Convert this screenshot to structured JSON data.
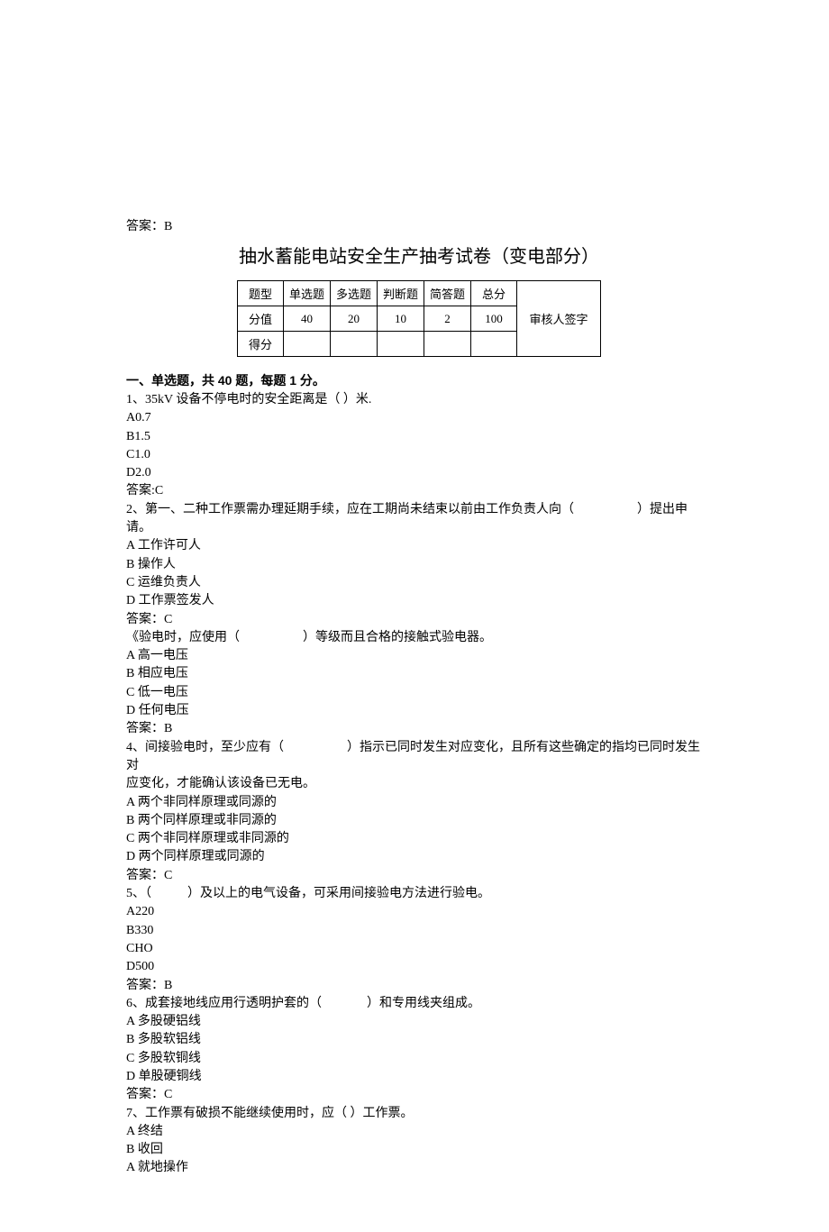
{
  "top_answer": "答案：B",
  "title": "抽水蓄能电站安全生产抽考试卷（变电部分）",
  "score_table": {
    "headers": [
      "题型",
      "单选题",
      "多选题",
      "判断题",
      "简答题",
      "总分",
      "审核人签字"
    ],
    "rows": [
      {
        "label": "分值",
        "cells": [
          "40",
          "20",
          "10",
          "2",
          "100",
          ""
        ]
      },
      {
        "label": "得分",
        "cells": [
          "",
          "",
          "",
          "",
          "",
          ""
        ]
      }
    ]
  },
  "section1_header": "一、单选题，共 40 题，每题 1 分。",
  "q1": {
    "stem": "1、35kV 设备不停电时的安全距离是（ ）米.",
    "a": "A0.7",
    "b": "B1.5",
    "c": "C1.0",
    "d": "D2.0",
    "ans": "答案:C"
  },
  "q2": {
    "stem_pre": "2、第一、二种工作票需办理延期手续，应在工期尚未结束以前由工作负责人向（",
    "stem_post": "）提出申请。",
    "a": "A 工作许可人",
    "b": "B 操作人",
    "c": "C 运维负责人",
    "d": "D 工作票签发人",
    "ans": "答案：C"
  },
  "q3": {
    "stem_pre": "《验电时，应使用（",
    "stem_post": "）等级而且合格的接触式验电器。",
    "a": "A 高一电压",
    "b": "B 相应电压",
    "c": "C 低一电压",
    "d": "D 任何电压",
    "ans": "答案：B"
  },
  "q4": {
    "stem_pre": "4、间接验电时，至少应有（",
    "stem_mid": "）指示已同时发生对应变化，且所有这些确定的指均已同时发生对",
    "stem_post": "应变化，才能确认该设备已无电。",
    "a": "A 两个非同样原理或同源的",
    "b": "B 两个同样原理或非同源的",
    "c": "C 两个非同样原理或非同源的",
    "d": "D 两个同样原理或同源的",
    "ans": "答案：C"
  },
  "q5": {
    "stem_pre": "5、（",
    "stem_post": "）及以上的电气设备，可采用间接验电方法进行验电。",
    "a": "A220",
    "b": "B330",
    "c": "CHO",
    "d": "D500",
    "ans": "答案：B"
  },
  "q6": {
    "stem_pre": "6、成套接地线应用行透明护套的（",
    "stem_post": "）和专用线夹组成。",
    "a": "A 多股硬铝线",
    "b": "B 多股软铝线",
    "c": "C 多股软铜线",
    "d": "D 单股硬铜线",
    "ans": "答案：C"
  },
  "q7": {
    "stem": "7、工作票有破损不能继续使用时，应（ ）工作票。",
    "a": "A 终结",
    "b": "B 收回",
    "c": "A 就地操作"
  }
}
